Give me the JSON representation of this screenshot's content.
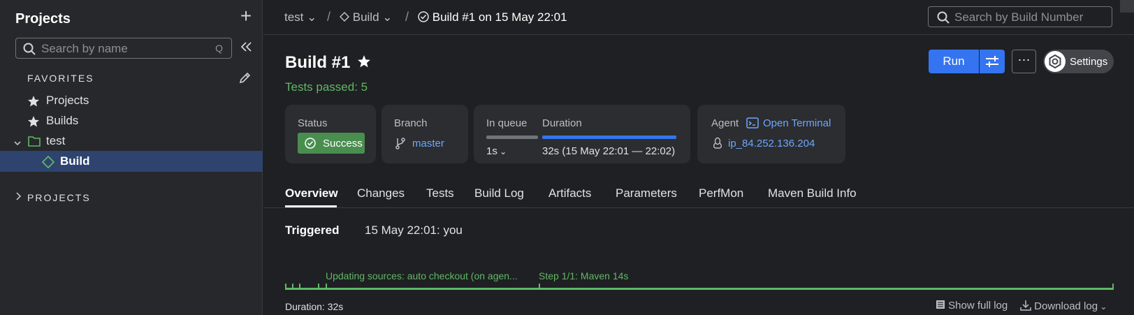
{
  "sidebar": {
    "header": "Projects",
    "search_placeholder": "Search by name",
    "search_shortcut": "Q",
    "favorites_title": "FAVORITES",
    "favorites": [
      {
        "label": "Projects",
        "icon": "star-icon"
      },
      {
        "label": "Builds",
        "icon": "star-icon"
      }
    ],
    "tree": [
      {
        "label": "test",
        "icon": "folder-icon",
        "expanded": true
      },
      {
        "label": "Build",
        "icon": "build-config-icon",
        "selected": true
      }
    ],
    "projects_title": "PROJECTS"
  },
  "topbar": {
    "breadcrumbs": [
      "test",
      "Build",
      "Build #1 on 15 May 22:01"
    ],
    "search_placeholder": "Search by Build Number"
  },
  "build": {
    "title": "Build #1",
    "status_text": "Tests passed: 5",
    "actions": {
      "run": "Run",
      "more": "···",
      "settings": "Settings"
    }
  },
  "info": {
    "status": {
      "label": "Status",
      "value": "Success"
    },
    "branch": {
      "label": "Branch",
      "value": "master"
    },
    "queue": {
      "label": "In queue",
      "value": "1s"
    },
    "duration": {
      "label": "Duration",
      "value": "32s (15 May 22:01 — 22:02)"
    },
    "agent": {
      "label": "Agent",
      "terminal": "Open Terminal",
      "value": "ip_84.252.136.204"
    }
  },
  "tabs": [
    "Overview",
    "Changes",
    "Tests",
    "Build Log",
    "Artifacts",
    "Parameters",
    "PerfMon",
    "Maven Build Info"
  ],
  "active_tab": "Overview",
  "overview": {
    "triggered_label": "Triggered",
    "triggered_value": "15 May 22:01: you",
    "timeline_labels": [
      "Updating sources: auto checkout (on agen...",
      "Step 1/1: Maven 14s"
    ],
    "duration": "Duration: 32s",
    "show_full_log": "Show full log",
    "download_log": "Download log"
  },
  "colors": {
    "accent": "#3574f0",
    "success": "#5fb865",
    "success_badge": "#4a8e4f",
    "link": "#6ea6ff",
    "selected_row": "#2e436e"
  }
}
